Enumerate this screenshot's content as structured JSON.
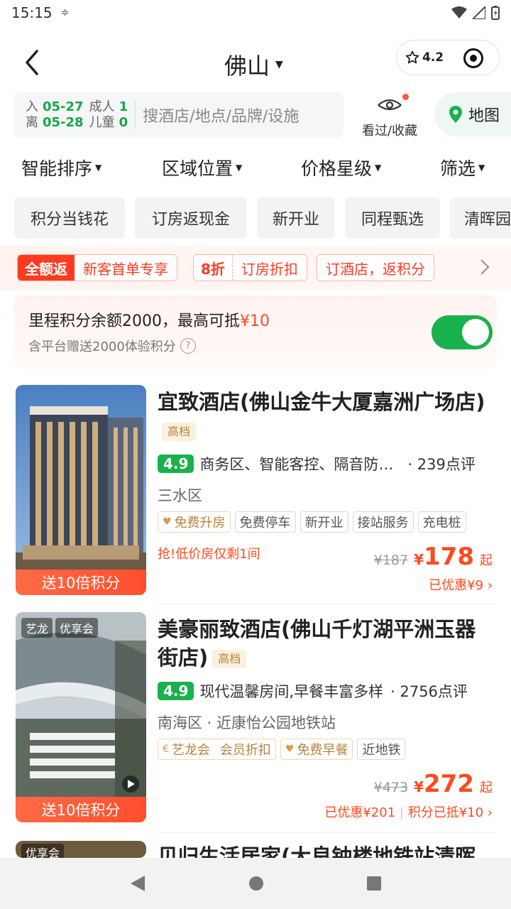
{
  "status_bar": {
    "time": "15:15",
    "sync_icon": "sync-icon"
  },
  "header": {
    "city": "佛山",
    "rating": "4.2"
  },
  "search": {
    "checkin_label": "入",
    "checkin_date": "05-27",
    "checkout_label": "离",
    "checkout_date": "05-28",
    "adults_label": "成人",
    "adults": "1",
    "children_label": "儿童",
    "children": "0",
    "placeholder": "搜酒店/地点/品牌/设施",
    "fav_label": "看过/收藏",
    "map_label": "地图"
  },
  "sort": [
    "智能排序",
    "区域位置",
    "价格星级",
    "筛选"
  ],
  "chips": [
    "积分当钱花",
    "订房返现金",
    "新开业",
    "同程甄选",
    "清晖园"
  ],
  "promo": {
    "tag1_highlight": "全额返",
    "tag1_text": "新客首单专享",
    "tag2_highlight": "8折",
    "tag2_text": "订房折扣",
    "tag3_text": "订酒店，返积分"
  },
  "points": {
    "title_prefix": "里程积分余额2000，最高可抵",
    "title_amount": "¥10",
    "subtitle": "含平台赠送2000体验积分",
    "help": "?",
    "enabled": true
  },
  "hotels": [
    {
      "name": "宜致酒店(佛山金牛大厦嘉洲广场店)",
      "grade": "高档",
      "score": "4.9",
      "highlights": "商务区、智能客控、隔音防…",
      "reviews": "· 239点评",
      "location": "三水区",
      "tags": [
        "免费升房",
        "免费停车",
        "新开业",
        "接站服务",
        "充电桩"
      ],
      "urgency": "抢!低价房仅剩1间",
      "old_price": "¥187",
      "currency": "¥",
      "price": "178",
      "price_suffix": "起",
      "saved": "已优惠¥9",
      "ribbon": "送10倍积分"
    },
    {
      "name": "美豪丽致酒店(佛山千灯湖平洲玉器街店)",
      "grade": "高档",
      "photo_badge1": "艺龙",
      "photo_badge2": "优享会",
      "score": "4.9",
      "highlights": "现代温馨房间,早餐丰富多样",
      "reviews": "· 2756点评",
      "location": "南海区 · 近康怡公园地铁站",
      "tags": [
        "艺龙会",
        "会员折扣",
        "免费早餐",
        "近地铁"
      ],
      "old_price": "¥473",
      "currency": "¥",
      "price": "272",
      "price_suffix": "起",
      "saved": "已优惠¥201",
      "saved2": "积分已抵¥10",
      "ribbon": "送10倍积分"
    },
    {
      "name": "贝归生活居家(大良钟楼地铁站清晖",
      "photo_badge1": "优享会"
    }
  ]
}
